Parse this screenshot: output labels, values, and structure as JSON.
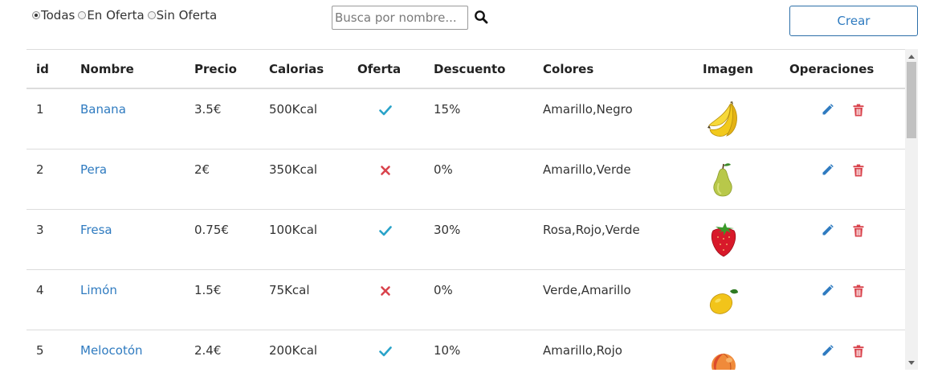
{
  "filters": {
    "options": [
      {
        "label": "Todas",
        "checked": true
      },
      {
        "label": "En Oferta",
        "checked": false
      },
      {
        "label": "Sin Oferta",
        "checked": false
      }
    ]
  },
  "search": {
    "placeholder": "Busca por nombre...",
    "value": "",
    "icon": "search-icon"
  },
  "create_button": {
    "label": "Crear"
  },
  "table": {
    "headers": [
      "id",
      "Nombre",
      "Precio",
      "Calorias",
      "Oferta",
      "Descuento",
      "Colores",
      "Imagen",
      "Operaciones"
    ],
    "rows": [
      {
        "id": "1",
        "nombre": "Banana",
        "precio": "3.5€",
        "calorias": "500Kcal",
        "oferta": true,
        "descuento": "15%",
        "colores": "Amarillo,Negro",
        "imagen": "banana"
      },
      {
        "id": "2",
        "nombre": "Pera",
        "precio": "2€",
        "calorias": "350Kcal",
        "oferta": false,
        "descuento": "0%",
        "colores": "Amarillo,Verde",
        "imagen": "pear"
      },
      {
        "id": "3",
        "nombre": "Fresa",
        "precio": "0.75€",
        "calorias": "100Kcal",
        "oferta": true,
        "descuento": "30%",
        "colores": "Rosa,Rojo,Verde",
        "imagen": "strawberry"
      },
      {
        "id": "4",
        "nombre": "Limón",
        "precio": "1.5€",
        "calorias": "75Kcal",
        "oferta": false,
        "descuento": "0%",
        "colores": "Verde,Amarillo",
        "imagen": "lemon"
      },
      {
        "id": "5",
        "nombre": "Melocotón",
        "precio": "2.4€",
        "calorias": "200Kcal",
        "oferta": true,
        "descuento": "10%",
        "colores": "Amarillo,Rojo",
        "imagen": "peach"
      }
    ],
    "operations": [
      "edit-pencil-icon",
      "delete-trash-icon"
    ]
  },
  "colors": {
    "link": "#2f7bc0",
    "check": "#2aa3c9",
    "cross": "#d9434c",
    "edit": "#2f7bc0",
    "delete": "#d9434c"
  }
}
